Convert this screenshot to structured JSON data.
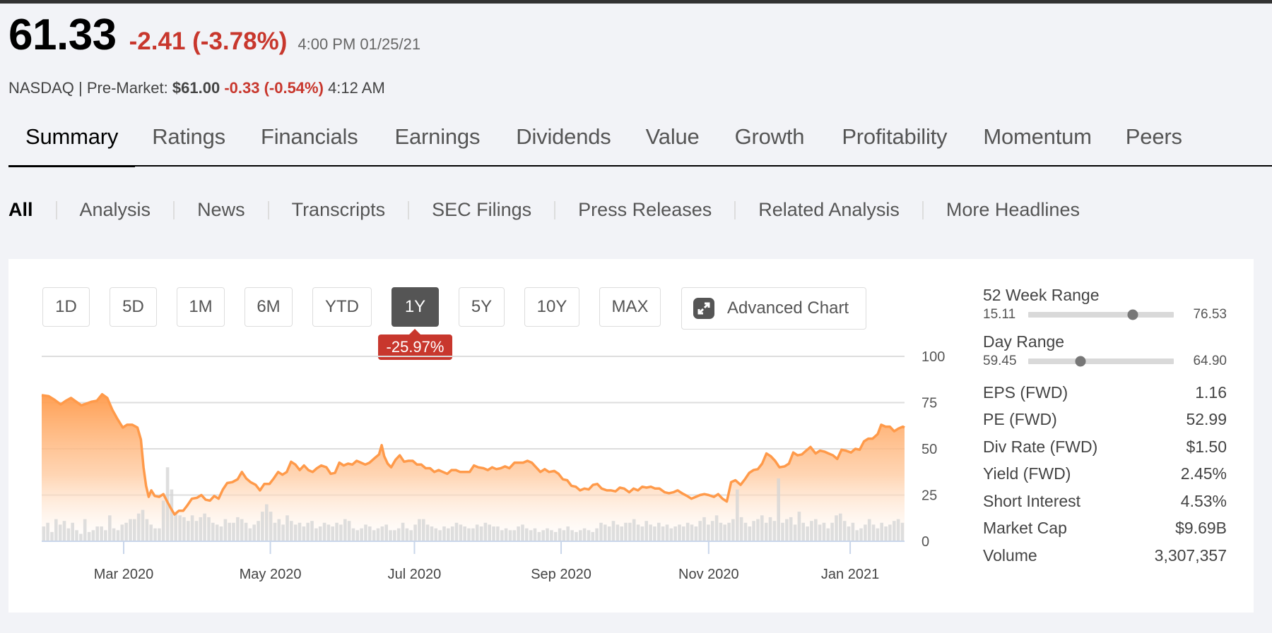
{
  "quote": {
    "price": "61.33",
    "change": "-2.41 (-3.78%)",
    "timestamp": "4:00 PM 01/25/21",
    "exchange_label": "NASDAQ | Pre-Market:",
    "premarket_price": "$61.00",
    "premarket_change": "-0.33 (-0.54%)",
    "premarket_time": "4:12 AM"
  },
  "tabs": [
    {
      "label": "Summary",
      "active": true
    },
    {
      "label": "Ratings"
    },
    {
      "label": "Financials"
    },
    {
      "label": "Earnings"
    },
    {
      "label": "Dividends"
    },
    {
      "label": "Value"
    },
    {
      "label": "Growth"
    },
    {
      "label": "Profitability"
    },
    {
      "label": "Momentum"
    },
    {
      "label": "Peers"
    }
  ],
  "subnav": [
    {
      "label": "All",
      "active": true
    },
    {
      "label": "Analysis"
    },
    {
      "label": "News"
    },
    {
      "label": "Transcripts"
    },
    {
      "label": "SEC Filings"
    },
    {
      "label": "Press Releases"
    },
    {
      "label": "Related Analysis"
    },
    {
      "label": "More Headlines"
    }
  ],
  "periods": [
    {
      "label": "1D"
    },
    {
      "label": "5D"
    },
    {
      "label": "1M"
    },
    {
      "label": "6M"
    },
    {
      "label": "YTD"
    },
    {
      "label": "1Y",
      "active": true,
      "badge": "-25.97%"
    },
    {
      "label": "5Y"
    },
    {
      "label": "10Y"
    },
    {
      "label": "MAX"
    }
  ],
  "advanced_chart": {
    "label": "Advanced Chart",
    "icon": "expand-icon"
  },
  "stats": {
    "week52": {
      "title": "52 Week Range",
      "low": "15.11",
      "high": "76.53",
      "position": 0.72
    },
    "day": {
      "title": "Day Range",
      "low": "59.45",
      "high": "64.90",
      "position": 0.36
    },
    "rows": [
      {
        "label": "EPS (FWD)",
        "value": "1.16"
      },
      {
        "label": "PE (FWD)",
        "value": "52.99"
      },
      {
        "label": "Div Rate (FWD)",
        "value": "$1.50"
      },
      {
        "label": "Yield (FWD)",
        "value": "2.45%"
      },
      {
        "label": "Short Interest",
        "value": "4.53%"
      },
      {
        "label": "Market Cap",
        "value": "$9.69B"
      },
      {
        "label": "Volume",
        "value": "3,307,357"
      }
    ]
  },
  "colors": {
    "accent_line": "#ff9a4a",
    "negative": "#c8372d",
    "volume": "#dcdcdc",
    "active_button": "#555555"
  },
  "chart_data": {
    "type": "area",
    "title": "",
    "xlabel": "",
    "ylabel": "",
    "ylim": [
      0,
      100
    ],
    "yticks": [
      "100",
      "75",
      "50",
      "25",
      "0"
    ],
    "ytick_values": [
      100,
      75,
      50,
      25,
      0
    ],
    "xticks": [
      {
        "label": "Mar 2020",
        "t": 0.095
      },
      {
        "label": "May 2020",
        "t": 0.265
      },
      {
        "label": "Jul 2020",
        "t": 0.432
      },
      {
        "label": "Sep 2020",
        "t": 0.602
      },
      {
        "label": "Nov 2020",
        "t": 0.773
      },
      {
        "label": "Jan 2021",
        "t": 0.937
      }
    ],
    "grid": true,
    "series": [
      {
        "name": "Price",
        "points": [
          [
            0.0,
            79
          ],
          [
            0.008,
            78.5
          ],
          [
            0.015,
            76.5
          ],
          [
            0.022,
            74
          ],
          [
            0.028,
            76
          ],
          [
            0.034,
            77.5
          ],
          [
            0.04,
            75.5
          ],
          [
            0.046,
            73.5
          ],
          [
            0.052,
            74.5
          ],
          [
            0.058,
            75.5
          ],
          [
            0.064,
            76
          ],
          [
            0.07,
            79.5
          ],
          [
            0.076,
            77.5
          ],
          [
            0.082,
            71
          ],
          [
            0.088,
            66
          ],
          [
            0.094,
            61.5
          ],
          [
            0.099,
            63
          ],
          [
            0.105,
            63
          ],
          [
            0.111,
            61.5
          ],
          [
            0.115,
            55
          ],
          [
            0.118,
            40
          ],
          [
            0.121,
            30
          ],
          [
            0.124,
            24
          ],
          [
            0.127,
            27.5
          ],
          [
            0.131,
            24.5
          ],
          [
            0.136,
            24
          ],
          [
            0.141,
            25.5
          ],
          [
            0.146,
            21
          ],
          [
            0.15,
            17.5
          ],
          [
            0.154,
            14.5
          ],
          [
            0.159,
            16.5
          ],
          [
            0.164,
            16.5
          ],
          [
            0.169,
            19.5
          ],
          [
            0.174,
            23
          ],
          [
            0.18,
            23.5
          ],
          [
            0.185,
            25
          ],
          [
            0.19,
            22.5
          ],
          [
            0.195,
            22
          ],
          [
            0.2,
            24.5
          ],
          [
            0.205,
            23
          ],
          [
            0.21,
            28
          ],
          [
            0.215,
            31.5
          ],
          [
            0.221,
            32
          ],
          [
            0.227,
            33.5
          ],
          [
            0.232,
            37.5
          ],
          [
            0.237,
            34
          ],
          [
            0.242,
            32
          ],
          [
            0.248,
            30.5
          ],
          [
            0.253,
            27.5
          ],
          [
            0.258,
            31
          ],
          [
            0.264,
            31
          ],
          [
            0.269,
            34
          ],
          [
            0.274,
            37.5
          ],
          [
            0.279,
            36
          ],
          [
            0.284,
            37.5
          ],
          [
            0.289,
            43
          ],
          [
            0.294,
            41.5
          ],
          [
            0.299,
            38.5
          ],
          [
            0.304,
            41
          ],
          [
            0.309,
            38.5
          ],
          [
            0.314,
            37.5
          ],
          [
            0.319,
            39.5
          ],
          [
            0.324,
            41
          ],
          [
            0.33,
            40
          ],
          [
            0.335,
            36.5
          ],
          [
            0.34,
            37
          ],
          [
            0.345,
            42.5
          ],
          [
            0.35,
            41
          ],
          [
            0.355,
            42
          ],
          [
            0.36,
            41.5
          ],
          [
            0.365,
            43.5
          ],
          [
            0.37,
            42.5
          ],
          [
            0.375,
            41.5
          ],
          [
            0.38,
            42.5
          ],
          [
            0.386,
            45
          ],
          [
            0.391,
            47
          ],
          [
            0.394,
            52
          ],
          [
            0.397,
            46
          ],
          [
            0.401,
            42
          ],
          [
            0.405,
            40
          ],
          [
            0.41,
            44
          ],
          [
            0.415,
            46.5
          ],
          [
            0.42,
            43
          ],
          [
            0.425,
            43.5
          ],
          [
            0.43,
            43.5
          ],
          [
            0.435,
            41.5
          ],
          [
            0.44,
            41.5
          ],
          [
            0.445,
            39.5
          ],
          [
            0.45,
            39.5
          ],
          [
            0.455,
            37.5
          ],
          [
            0.46,
            38.5
          ],
          [
            0.465,
            37.5
          ],
          [
            0.47,
            36.5
          ],
          [
            0.475,
            38.5
          ],
          [
            0.48,
            38.5
          ],
          [
            0.485,
            37.5
          ],
          [
            0.491,
            37.5
          ],
          [
            0.496,
            37.5
          ],
          [
            0.501,
            41
          ],
          [
            0.506,
            40
          ],
          [
            0.512,
            39.5
          ],
          [
            0.517,
            38.5
          ],
          [
            0.522,
            40
          ],
          [
            0.527,
            39
          ],
          [
            0.532,
            39.5
          ],
          [
            0.537,
            40.5
          ],
          [
            0.542,
            39.5
          ],
          [
            0.548,
            42.5
          ],
          [
            0.553,
            42.5
          ],
          [
            0.558,
            42.5
          ],
          [
            0.563,
            43.5
          ],
          [
            0.568,
            42.5
          ],
          [
            0.573,
            40
          ],
          [
            0.578,
            37.5
          ],
          [
            0.583,
            39
          ],
          [
            0.588,
            37.5
          ],
          [
            0.594,
            38
          ],
          [
            0.599,
            36.5
          ],
          [
            0.604,
            33.5
          ],
          [
            0.609,
            33
          ],
          [
            0.614,
            30
          ],
          [
            0.619,
            29.5
          ],
          [
            0.624,
            27.5
          ],
          [
            0.629,
            28.5
          ],
          [
            0.634,
            28
          ],
          [
            0.639,
            30.5
          ],
          [
            0.644,
            31
          ],
          [
            0.649,
            28.5
          ],
          [
            0.655,
            27.5
          ],
          [
            0.66,
            27.5
          ],
          [
            0.665,
            27
          ],
          [
            0.67,
            29
          ],
          [
            0.675,
            28.5
          ],
          [
            0.681,
            26.5
          ],
          [
            0.686,
            28.5
          ],
          [
            0.691,
            27.5
          ],
          [
            0.696,
            29.5
          ],
          [
            0.701,
            29
          ],
          [
            0.706,
            29.5
          ],
          [
            0.711,
            28.5
          ],
          [
            0.716,
            28.5
          ],
          [
            0.722,
            26.5
          ],
          [
            0.727,
            26
          ],
          [
            0.732,
            26.5
          ],
          [
            0.737,
            27.5
          ],
          [
            0.742,
            26
          ],
          [
            0.748,
            24.5
          ],
          [
            0.753,
            23
          ],
          [
            0.758,
            24
          ],
          [
            0.763,
            25
          ],
          [
            0.768,
            25.5
          ],
          [
            0.773,
            25
          ],
          [
            0.779,
            24
          ],
          [
            0.784,
            25.5
          ],
          [
            0.789,
            23
          ],
          [
            0.794,
            21.5
          ],
          [
            0.799,
            32
          ],
          [
            0.804,
            33
          ],
          [
            0.81,
            30.5
          ],
          [
            0.815,
            33.5
          ],
          [
            0.82,
            37
          ],
          [
            0.825,
            38.5
          ],
          [
            0.83,
            39
          ],
          [
            0.835,
            42
          ],
          [
            0.84,
            47.5
          ],
          [
            0.845,
            46
          ],
          [
            0.85,
            43.5
          ],
          [
            0.855,
            40
          ],
          [
            0.861,
            40.5
          ],
          [
            0.866,
            42
          ],
          [
            0.871,
            48
          ],
          [
            0.876,
            46.5
          ],
          [
            0.881,
            47
          ],
          [
            0.886,
            49
          ],
          [
            0.891,
            51
          ],
          [
            0.897,
            47.5
          ],
          [
            0.902,
            49
          ],
          [
            0.907,
            48.5
          ],
          [
            0.912,
            47.5
          ],
          [
            0.917,
            46.5
          ],
          [
            0.922,
            44.5
          ],
          [
            0.927,
            49.5
          ],
          [
            0.932,
            49
          ],
          [
            0.938,
            48
          ],
          [
            0.943,
            50
          ],
          [
            0.948,
            49.5
          ],
          [
            0.953,
            54
          ],
          [
            0.958,
            55.5
          ],
          [
            0.963,
            55.5
          ],
          [
            0.969,
            58
          ],
          [
            0.973,
            63
          ],
          [
            0.978,
            62
          ],
          [
            0.983,
            62
          ],
          [
            0.988,
            59.5
          ],
          [
            0.993,
            61
          ],
          [
            0.998,
            62
          ],
          [
            1.0,
            61.5
          ]
        ]
      }
    ],
    "volume_note": "relative daily volume bars",
    "volume": [
      0.08,
      0.1,
      0.05,
      0.12,
      0.09,
      0.11,
      0.07,
      0.1,
      0.06,
      0.04,
      0.12,
      0.05,
      0.06,
      0.08,
      0.08,
      0.06,
      0.14,
      0.07,
      0.06,
      0.09,
      0.1,
      0.12,
      0.12,
      0.15,
      0.17,
      0.12,
      0.09,
      0.07,
      0.07,
      0.22,
      0.4,
      0.28,
      0.15,
      0.14,
      0.13,
      0.11,
      0.14,
      0.11,
      0.13,
      0.15,
      0.13,
      0.1,
      0.09,
      0.08,
      0.12,
      0.1,
      0.1,
      0.13,
      0.12,
      0.1,
      0.07,
      0.09,
      0.11,
      0.16,
      0.2,
      0.16,
      0.1,
      0.12,
      0.09,
      0.14,
      0.11,
      0.09,
      0.1,
      0.08,
      0.1,
      0.11,
      0.07,
      0.08,
      0.1,
      0.09,
      0.08,
      0.1,
      0.09,
      0.12,
      0.11,
      0.07,
      0.06,
      0.07,
      0.09,
      0.08,
      0.06,
      0.07,
      0.08,
      0.09,
      0.06,
      0.06,
      0.07,
      0.1,
      0.07,
      0.06,
      0.09,
      0.12,
      0.12,
      0.09,
      0.08,
      0.07,
      0.06,
      0.08,
      0.07,
      0.08,
      0.1,
      0.09,
      0.08,
      0.07,
      0.07,
      0.09,
      0.08,
      0.1,
      0.09,
      0.08,
      0.08,
      0.06,
      0.07,
      0.06,
      0.06,
      0.08,
      0.09,
      0.07,
      0.06,
      0.07,
      0.05,
      0.06,
      0.07,
      0.06,
      0.05,
      0.07,
      0.06,
      0.08,
      0.06,
      0.05,
      0.06,
      0.07,
      0.06,
      0.05,
      0.07,
      0.1,
      0.09,
      0.08,
      0.11,
      0.09,
      0.08,
      0.1,
      0.1,
      0.12,
      0.09,
      0.08,
      0.11,
      0.09,
      0.08,
      0.1,
      0.08,
      0.09,
      0.07,
      0.08,
      0.09,
      0.08,
      0.1,
      0.09,
      0.08,
      0.11,
      0.13,
      0.09,
      0.11,
      0.14,
      0.1,
      0.09,
      0.1,
      0.12,
      0.28,
      0.13,
      0.1,
      0.08,
      0.11,
      0.12,
      0.14,
      0.1,
      0.13,
      0.11,
      0.34,
      0.1,
      0.12,
      0.13,
      0.09,
      0.16,
      0.1,
      0.08,
      0.11,
      0.12,
      0.09,
      0.1,
      0.07,
      0.1,
      0.14,
      0.15,
      0.11,
      0.08,
      0.1,
      0.06,
      0.07,
      0.09,
      0.12,
      0.09,
      0.07,
      0.1,
      0.08,
      0.09,
      0.11,
      0.12,
      0.1
    ]
  }
}
